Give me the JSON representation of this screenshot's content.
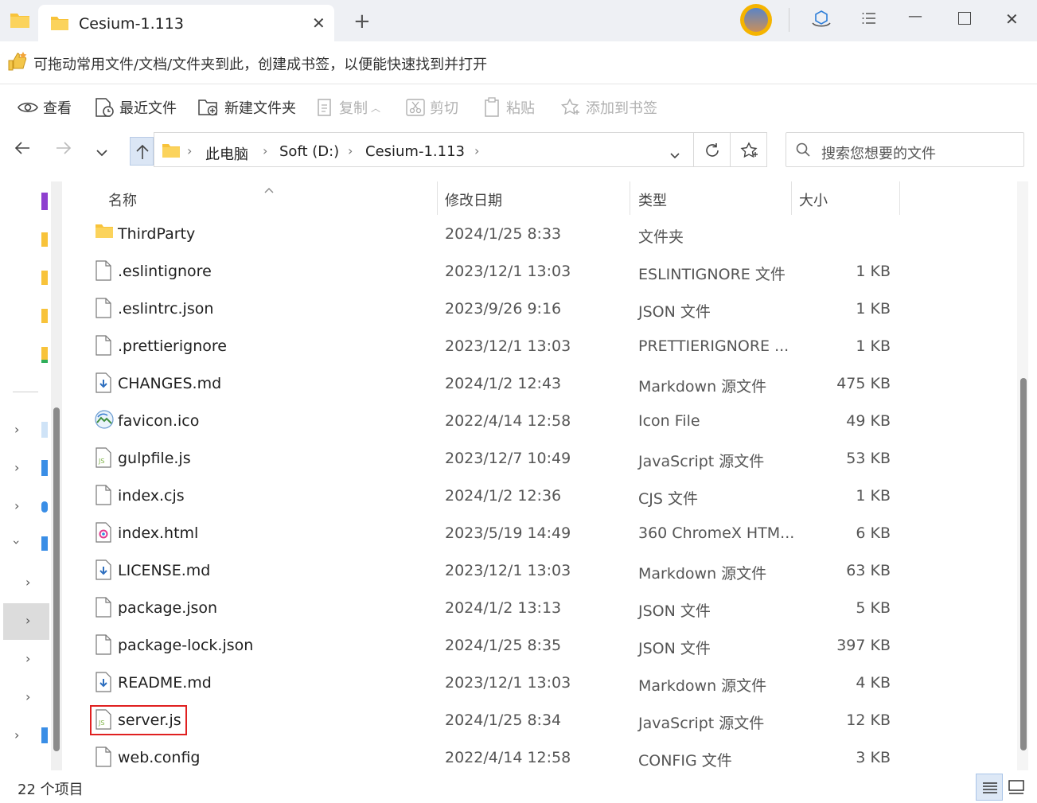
{
  "window": {
    "tab_title": "Cesium-1.113",
    "tab_close": "✕",
    "new_tab": "+",
    "minimize": "—",
    "close": "✕"
  },
  "hint_bar": {
    "text": "可拖动常用文件/文档/文件夹到此，创建成书签，以便能快速找到并打开"
  },
  "toolbar": {
    "view": "查看",
    "recent": "最近文件",
    "new_folder": "新建文件夹",
    "copy": "复制",
    "cut": "剪切",
    "paste": "粘贴",
    "add_bookmark": "添加到书签"
  },
  "address": {
    "crumbs": [
      "此电脑",
      "Soft (D:)",
      "Cesium-1.113"
    ],
    "search_placeholder": "搜索您想要的文件"
  },
  "columns": {
    "name": "名称",
    "date": "修改日期",
    "type": "类型",
    "size": "大小"
  },
  "files": [
    {
      "name": "ThirdParty",
      "date": "2024/1/25 8:33",
      "type": "文件夹",
      "size": "",
      "icon": "folder-icon"
    },
    {
      "name": ".eslintignore",
      "date": "2023/12/1 13:03",
      "type": "ESLINTIGNORE 文件",
      "size": "1 KB",
      "icon": "file-icon"
    },
    {
      "name": ".eslintrc.json",
      "date": "2023/9/26 9:16",
      "type": "JSON 文件",
      "size": "1 KB",
      "icon": "file-icon"
    },
    {
      "name": ".prettierignore",
      "date": "2023/12/1 13:03",
      "type": "PRETTIERIGNORE ...",
      "size": "1 KB",
      "icon": "file-icon"
    },
    {
      "name": "CHANGES.md",
      "date": "2024/1/2 12:43",
      "type": "Markdown 源文件",
      "size": "475 KB",
      "icon": "markdown-icon"
    },
    {
      "name": "favicon.ico",
      "date": "2022/4/14 12:58",
      "type": "Icon File",
      "size": "49 KB",
      "icon": "image-icon"
    },
    {
      "name": "gulpfile.js",
      "date": "2023/12/7 10:49",
      "type": "JavaScript 源文件",
      "size": "53 KB",
      "icon": "js-icon"
    },
    {
      "name": "index.cjs",
      "date": "2024/1/2 12:36",
      "type": "CJS 文件",
      "size": "1 KB",
      "icon": "file-icon"
    },
    {
      "name": "index.html",
      "date": "2023/5/19 14:49",
      "type": "360 ChromeX HTM...",
      "size": "6 KB",
      "icon": "html-icon"
    },
    {
      "name": "LICENSE.md",
      "date": "2023/12/1 13:03",
      "type": "Markdown 源文件",
      "size": "63 KB",
      "icon": "markdown-icon"
    },
    {
      "name": "package.json",
      "date": "2024/1/2 13:13",
      "type": "JSON 文件",
      "size": "5 KB",
      "icon": "file-icon"
    },
    {
      "name": "package-lock.json",
      "date": "2024/1/25 8:35",
      "type": "JSON 文件",
      "size": "397 KB",
      "icon": "file-icon"
    },
    {
      "name": "README.md",
      "date": "2023/12/1 13:03",
      "type": "Markdown 源文件",
      "size": "4 KB",
      "icon": "markdown-icon"
    },
    {
      "name": "server.js",
      "date": "2024/1/25 8:34",
      "type": "JavaScript 源文件",
      "size": "12 KB",
      "icon": "js-icon"
    },
    {
      "name": "web.config",
      "date": "2022/4/14 12:58",
      "type": "CONFIG 文件",
      "size": "3 KB",
      "icon": "file-icon"
    }
  ],
  "status": {
    "item_count": "22 个项目"
  },
  "colors": {
    "titlebar_bg": "#eef0f4",
    "folder_yellow": "#f8c33a",
    "highlight_red": "#e02020",
    "js_green": "#7fb347"
  }
}
